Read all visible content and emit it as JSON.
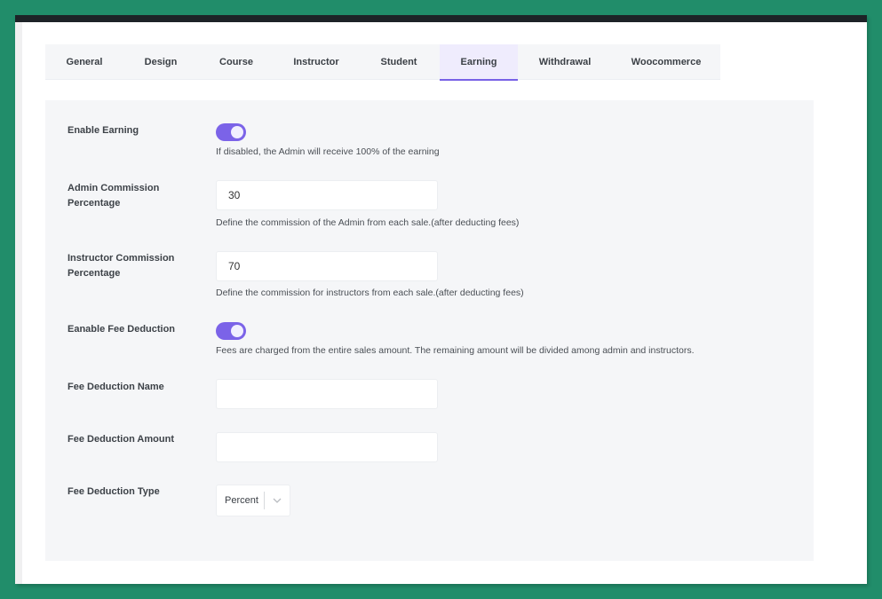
{
  "tabs": [
    {
      "label": "General",
      "active": false
    },
    {
      "label": "Design",
      "active": false
    },
    {
      "label": "Course",
      "active": false
    },
    {
      "label": "Instructor",
      "active": false
    },
    {
      "label": "Student",
      "active": false
    },
    {
      "label": "Earning",
      "active": true
    },
    {
      "label": "Withdrawal",
      "active": false
    },
    {
      "label": "Woocommerce",
      "active": false
    }
  ],
  "settings": {
    "enable_earning": {
      "label": "Enable Earning",
      "enabled": true,
      "help": "If disabled, the Admin will receive 100% of the earning"
    },
    "admin_commission": {
      "label": "Admin Commission Percentage",
      "value": "30",
      "help": "Define the commission of the Admin from each sale.(after deducting fees)"
    },
    "instructor_commission": {
      "label_line1": "Instructor Commission",
      "label_line2": "Percentage",
      "value": "70",
      "help": "Define the commission for instructors from each sale.(after deducting fees)"
    },
    "fee_deduction": {
      "label": "Eanable Fee Deduction",
      "enabled": true,
      "help": "Fees are charged from the entire sales amount. The remaining amount will be divided among admin and instructors."
    },
    "fee_name": {
      "label": "Fee Deduction Name",
      "value": ""
    },
    "fee_amount": {
      "label": "Fee Deduction Amount",
      "value": ""
    },
    "fee_type": {
      "label": "Fee Deduction Type",
      "selected": "Percent"
    }
  },
  "colors": {
    "accent": "#7b63e8",
    "background": "#218d6a",
    "panel": "#f5f6f8"
  }
}
